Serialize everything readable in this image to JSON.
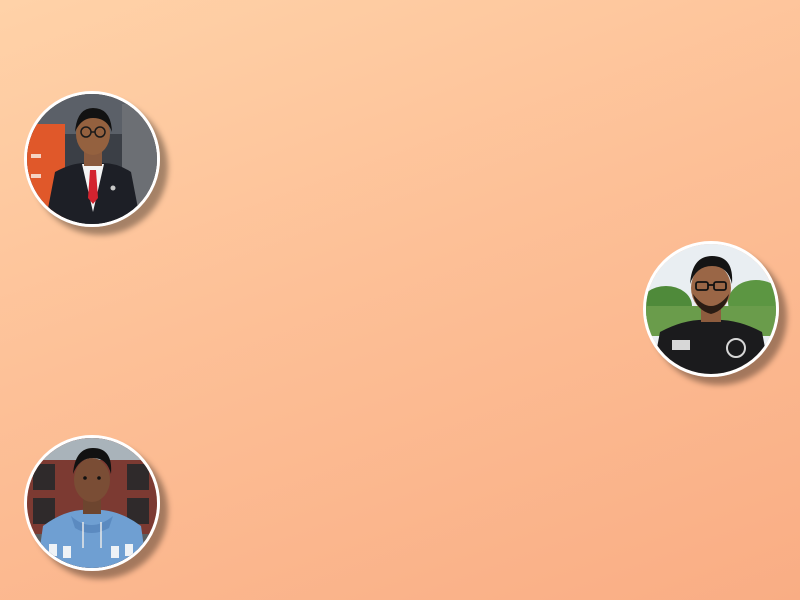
{
  "page": {
    "background_gradient": [
      "#ffd2a8",
      "#f9ad84"
    ]
  },
  "profiles": [
    {
      "photo": "avatar-photo-woman-in-blazer"
    },
    {
      "photo": "avatar-photo-man-in-black-tshirt"
    },
    {
      "photo": "avatar-photo-man-in-blue-hoodie"
    }
  ]
}
